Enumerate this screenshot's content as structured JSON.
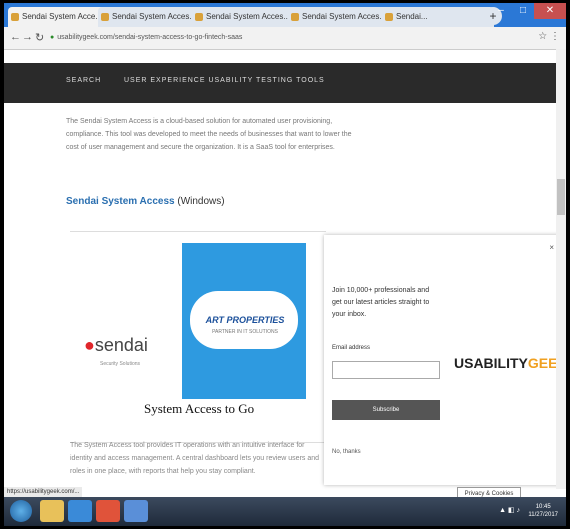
{
  "browser": {
    "tabs": [
      {
        "label": "Sendai System Acce..."
      },
      {
        "label": "Sendai System Acces..."
      },
      {
        "label": "Sendai System Acces..."
      },
      {
        "label": "Sendai System Acces..."
      },
      {
        "label": "Sendai..."
      }
    ],
    "url": "usabilitygeek.com/sendai-system-access-to-go-fintech-saas",
    "new_tab": "+"
  },
  "site": {
    "nav": [
      "SEARCH",
      "USER EXPERIENCE USABILITY TESTING TOOLS"
    ]
  },
  "article": {
    "intro_lines": [
      "The Sendai System Access is a cloud-based solution for automated user provisioning,",
      "compliance. This tool was developed to meet the needs of businesses that want to lower the",
      "cost of user management and secure the organization. It is a SaaS tool for enterprises."
    ],
    "section_title": "Sendai System Access",
    "section_suffix": "(Windows)",
    "cloud_brand": "ART PROPERTIES",
    "cloud_tagline": "PARTNER IN IT SOLUTIONS",
    "sendai_logo": "sendai",
    "sendai_sub": "Security Solutions",
    "system_access_title": "System Access to Go",
    "bottom_lines": [
      "The System Access tool provides IT operations with an intuitive interface for",
      "identity and access management. A central dashboard lets you review users and",
      "roles in one place, with reports that help you stay compliant."
    ]
  },
  "popup": {
    "close": "×",
    "text_lines": [
      "Join 10,000+ professionals and",
      "get our latest articles straight to",
      "your inbox."
    ],
    "email_label": "Email address",
    "email_placeholder": "",
    "subscribe": "Subscribe",
    "footer": "No, thanks",
    "logo_main": "USABILITY",
    "logo_accent": "GEEK",
    "tooltip": "Privacy & Cookies Policy"
  },
  "status_bar": "https://usabilitygeek.com/...",
  "taskbar": {
    "time": "10:45",
    "date": "11/27/2017"
  }
}
